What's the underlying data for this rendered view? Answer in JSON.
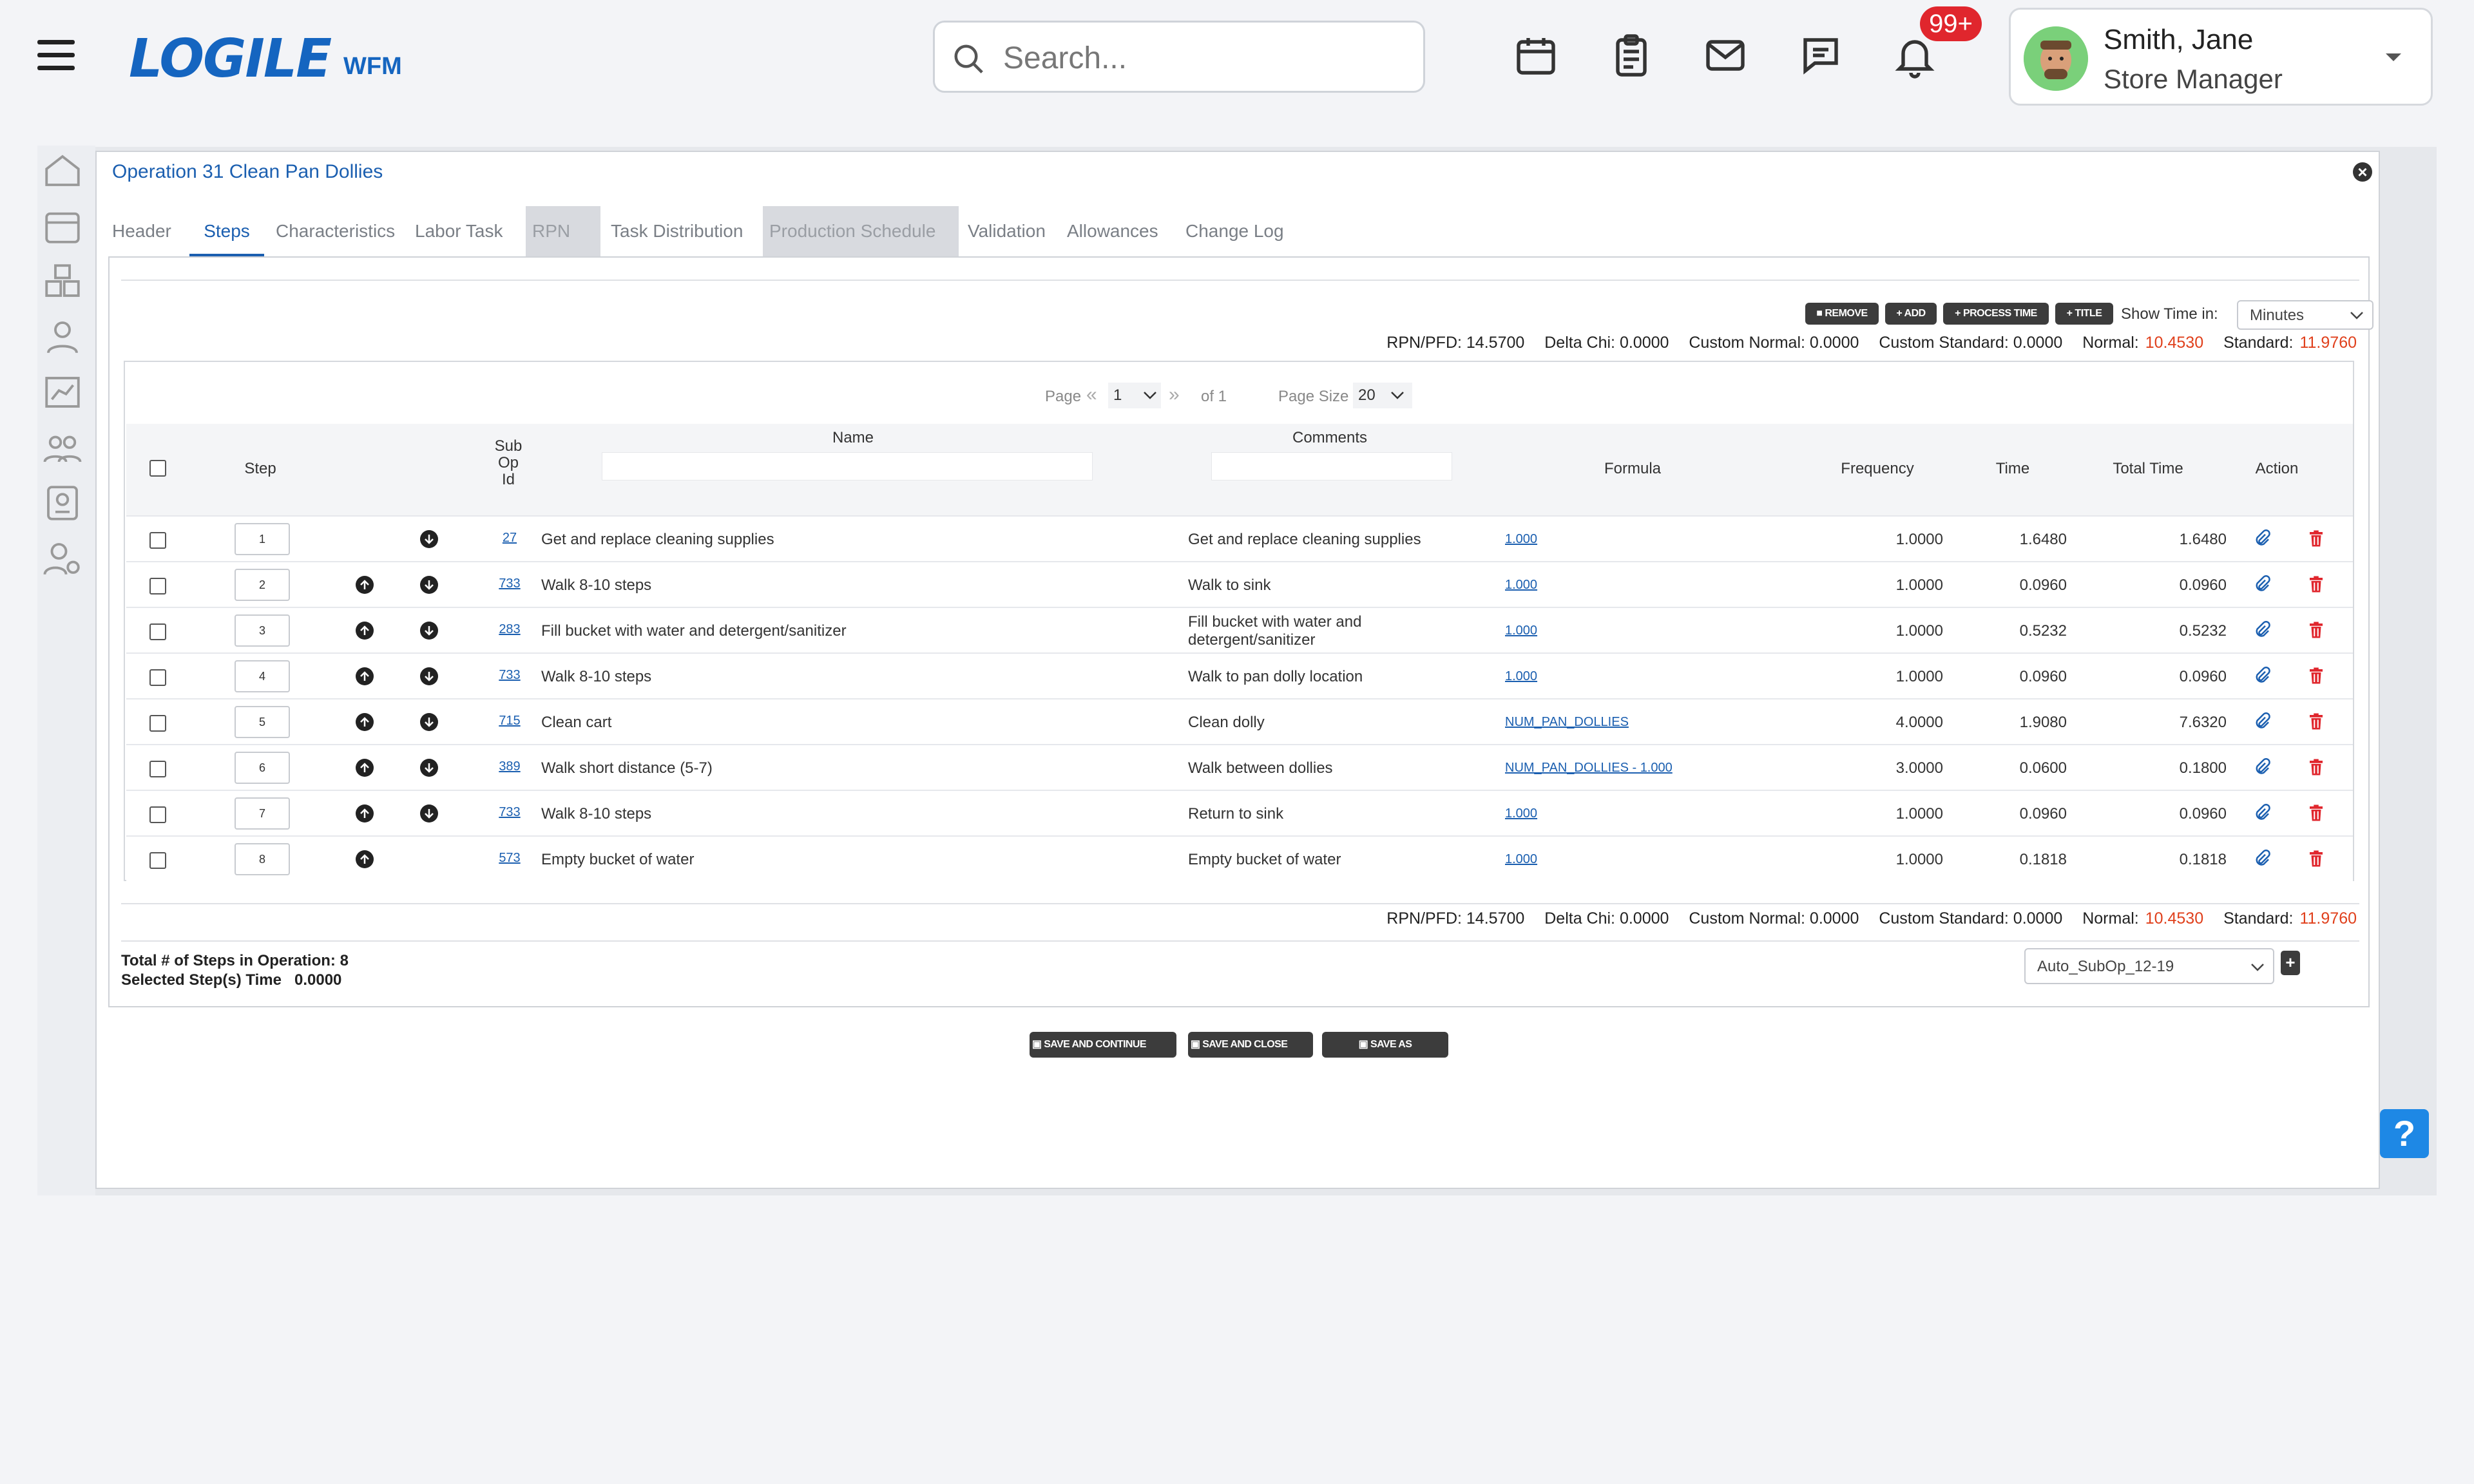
{
  "header": {
    "logo": "LOGILE",
    "logo_sub": "WFM",
    "search_placeholder": "Search...",
    "notification_count": "99+",
    "user_name": "Smith, Jane",
    "user_role": "Store Manager"
  },
  "modal": {
    "title": "Operation 31 Clean Pan Dollies",
    "close": "×",
    "tabs": [
      {
        "label": "Header"
      },
      {
        "label": "Steps"
      },
      {
        "label": "Characteristics"
      },
      {
        "label": "Labor Task"
      },
      {
        "label": "RPN"
      },
      {
        "label": "Task Distribution"
      },
      {
        "label": "Production Schedule"
      },
      {
        "label": "Validation"
      },
      {
        "label": "Allowances"
      },
      {
        "label": "Change Log"
      }
    ],
    "toolbar": {
      "remove": "REMOVE",
      "add": "ADD",
      "process_time": "PROCESS TIME",
      "title": "TITLE",
      "show_time_label": "Show Time in:",
      "show_time_value": "Minutes"
    },
    "stats": {
      "rpn_label": "RPN/PFD:",
      "rpn": "14.5700",
      "delta_label": "Delta Chi:",
      "delta": "0.0000",
      "cnormal_label": "Custom Normal:",
      "cnormal": "0.0000",
      "cstandard_label": "Custom Standard:",
      "cstandard": "0.0000",
      "normal_label": "Normal:",
      "normal": "10.4530",
      "standard_label": "Standard:",
      "standard": "11.9760"
    },
    "pager": {
      "page_label": "Page",
      "page_value": "1",
      "of_label": "of 1",
      "size_label": "Page Size",
      "size_value": "20"
    },
    "columns": {
      "step": "Step",
      "subop": "Sub\nOp\nId",
      "name": "Name",
      "comments": "Comments",
      "formula": "Formula",
      "frequency": "Frequency",
      "time": "Time",
      "total_time": "Total Time",
      "action": "Action"
    },
    "rows": [
      {
        "step": "1",
        "subop": "27",
        "name": "Get and replace cleaning supplies",
        "comment": "Get and replace cleaning supplies",
        "formula": "1.000",
        "frequency": "1.0000",
        "time": "1.6480",
        "total": "1.6480"
      },
      {
        "step": "2",
        "subop": "733",
        "name": "Walk 8-10 steps",
        "comment": "Walk to sink",
        "formula": "1.000",
        "frequency": "1.0000",
        "time": "0.0960",
        "total": "0.0960"
      },
      {
        "step": "3",
        "subop": "283",
        "name": "Fill bucket with water and detergent/sanitizer",
        "comment": "Fill bucket with water and\ndetergent/sanitizer",
        "formula": "1.000",
        "frequency": "1.0000",
        "time": "0.5232",
        "total": "0.5232"
      },
      {
        "step": "4",
        "subop": "733",
        "name": "Walk 8-10 steps",
        "comment": "Walk to pan dolly location",
        "formula": "1.000",
        "frequency": "1.0000",
        "time": "0.0960",
        "total": "0.0960"
      },
      {
        "step": "5",
        "subop": "715",
        "name": "Clean cart",
        "comment": "Clean dolly",
        "formula": "NUM_PAN_DOLLIES",
        "frequency": "4.0000",
        "time": "1.9080",
        "total": "7.6320"
      },
      {
        "step": "6",
        "subop": "389",
        "name": "Walk short distance (5-7)",
        "comment": "Walk between dollies",
        "formula": "NUM_PAN_DOLLIES - 1.000",
        "frequency": "3.0000",
        "time": "0.0600",
        "total": "0.1800"
      },
      {
        "step": "7",
        "subop": "733",
        "name": "Walk 8-10 steps",
        "comment": "Return to sink",
        "formula": "1.000",
        "frequency": "1.0000",
        "time": "0.0960",
        "total": "0.0960"
      },
      {
        "step": "8",
        "subop": "573",
        "name": "Empty bucket of water",
        "comment": "Empty bucket of water",
        "formula": "1.000",
        "frequency": "1.0000",
        "time": "0.1818",
        "total": "0.1818"
      }
    ],
    "footer": {
      "total_steps": "Total # of Steps in Operation: 8",
      "selected_time": "Selected Step(s) Time   0.0000",
      "subop_select": "Auto_SubOp_12-19"
    },
    "buttons": {
      "save_continue": "SAVE AND CONTINUE",
      "save_close": "SAVE AND CLOSE",
      "save_as": "SAVE AS"
    }
  },
  "help": "?",
  "colors": {
    "accent": "#1b5fb0",
    "danger": "#e0262d",
    "highlight": "#e0401c"
  }
}
